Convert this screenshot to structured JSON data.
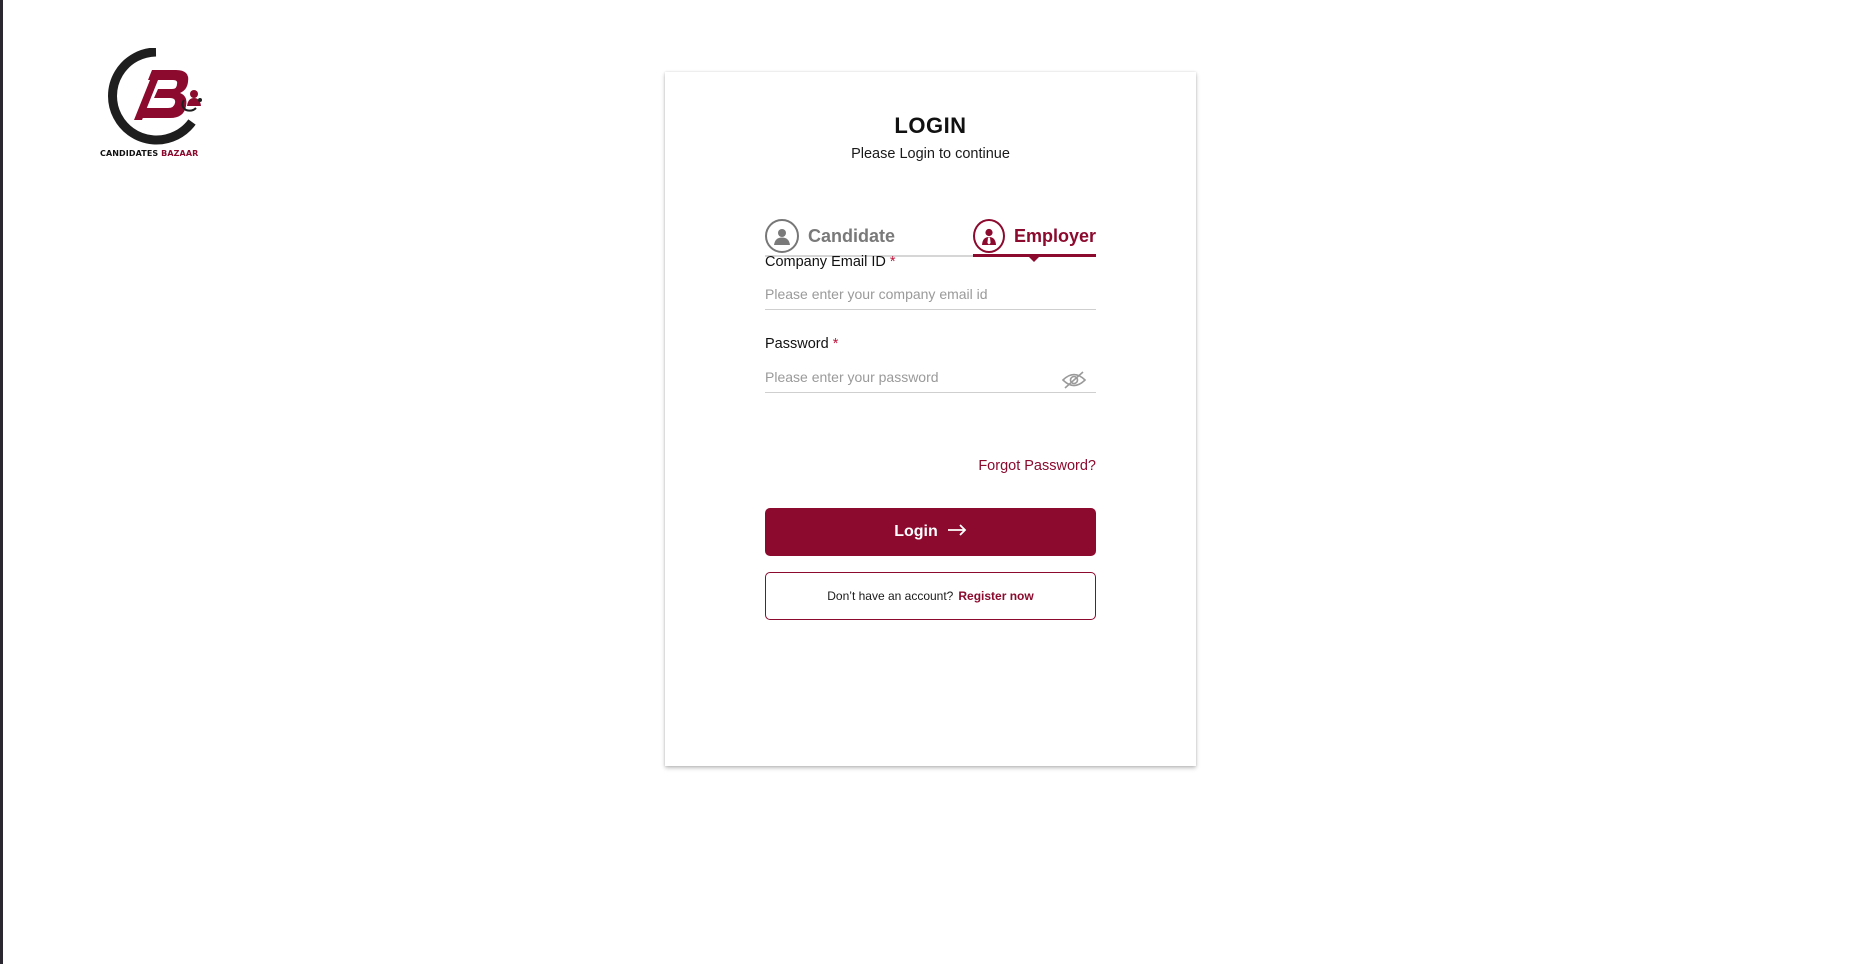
{
  "brand": {
    "logo_icon": "cb-logo-icon",
    "logo_text_primary": "CANDIDATES",
    "logo_text_accent": "BAZAAR",
    "accent_color": "#8b0a2e"
  },
  "login_card": {
    "title": "LOGIN",
    "subtitle": "Please Login to continue",
    "tabs": [
      {
        "label": "Candidate",
        "icon": "user-icon",
        "selected": false
      },
      {
        "label": "Employer",
        "icon": "employer-icon",
        "selected": true
      }
    ],
    "email": {
      "label": "Company Email ID",
      "required_mark": "*",
      "placeholder": "Please enter your company email id",
      "value": ""
    },
    "password": {
      "label": "Password",
      "required_mark": "*",
      "placeholder": "Please enter your password",
      "value": "",
      "toggle_icon": "eye-off-icon"
    },
    "forgot_password": "Forgot Password?",
    "login_button": "Login",
    "login_button_icon": "arrow-right-icon",
    "register_prompt": "Don’t have an account?",
    "register_link": "Register now"
  }
}
